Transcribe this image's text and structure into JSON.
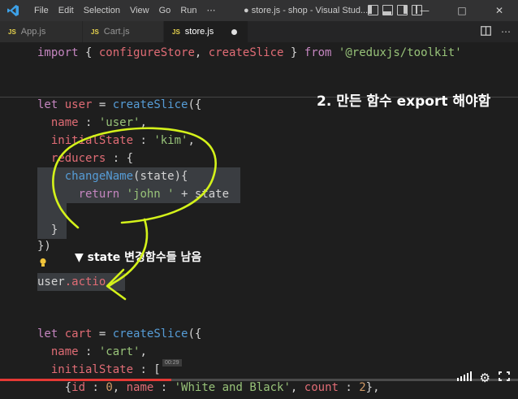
{
  "titlebar": {
    "menu": [
      "File",
      "Edit",
      "Selection",
      "View",
      "Go",
      "Run",
      "⋯"
    ],
    "title": "● store.js - shop - Visual Stud...",
    "controls": [
      "—",
      "□",
      "✕"
    ]
  },
  "tabs": [
    {
      "badge": "JS",
      "label": "App.js"
    },
    {
      "badge": "JS",
      "label": "Cart.js"
    },
    {
      "badge": "JS",
      "label": "store.js"
    }
  ],
  "code": {
    "l1": {
      "kw1": "import",
      "p1": " { ",
      "f1": "configureStore",
      "p2": ", ",
      "f2": "createSlice",
      "p3": " } ",
      "kw2": "from",
      "p4": " ",
      "s1": "'@reduxjs/toolkit'"
    },
    "l2": {
      "kw": "let",
      "v": " user",
      "p1": " = ",
      "f": "createSlice",
      "p2": "({"
    },
    "l3": {
      "k": "  name",
      "p1": " : ",
      "s": "'user'",
      "p2": ","
    },
    "l4": {
      "k": "  initialState",
      "p1": " : ",
      "s": "'kim'",
      "p2": ","
    },
    "l5": {
      "k": "  reducers",
      "p1": " : {"
    },
    "l6": {
      "f": "    changeName",
      "p1": "(state){"
    },
    "l7": {
      "kw": "      return",
      "p1": " ",
      "s": "'john '",
      "p2": " + state"
    },
    "l8": {
      "p": "  }"
    },
    "l9": {
      "p": "})"
    },
    "l10": {
      "v": "user",
      "p": ".actio"
    },
    "l11": {
      "kw": "let",
      "v": " cart",
      "p1": " = ",
      "f": "createSlice",
      "p2": "({"
    },
    "l12": {
      "k": "  name",
      "p1": " : ",
      "s": "'cart'",
      "p2": ","
    },
    "l13": {
      "k": "  initialState",
      "p1": " : ["
    },
    "l14": {
      "p1": "    {",
      "k1": "id",
      "p2": " : ",
      "n1": "0",
      "p3": ", ",
      "k2": "name",
      "p4": " : ",
      "s": "'White and Black'",
      "p5": ", ",
      "k3": "count",
      "p6": " : ",
      "n2": "2",
      "p7": "},"
    }
  },
  "annotations": {
    "export_note": "2. 만든 함수 export 해야함",
    "state_note": "▼ state 변경함수들 남음"
  },
  "player": {
    "progress_fraction": 0.33,
    "chip": "00:29"
  },
  "colors": {
    "accent_scribble": "#d4f21a",
    "keyword": "#c586c0",
    "string": "#ce9178",
    "function": "#dcdcaa"
  }
}
